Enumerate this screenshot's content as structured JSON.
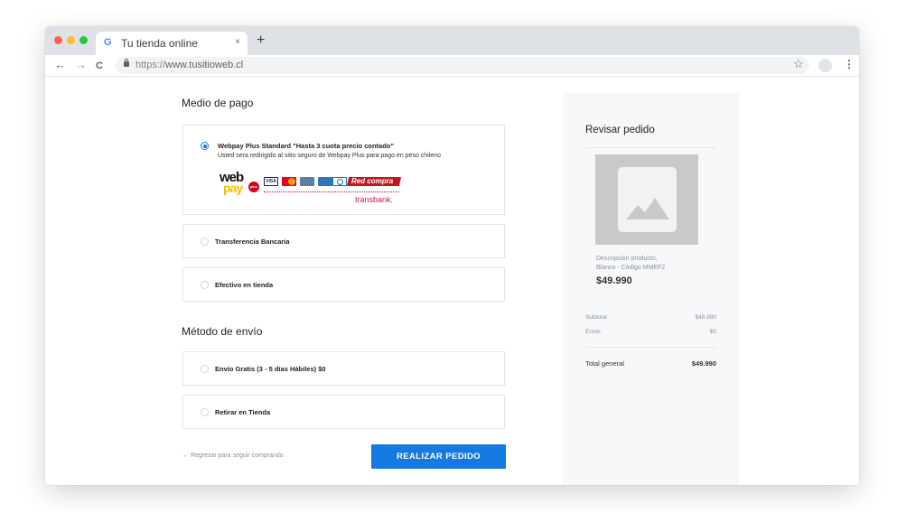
{
  "browser": {
    "tab_title": "Tu tienda online",
    "tab_icon_letter": "G",
    "tab_close": "×",
    "new_tab": "+",
    "url_protocol": "https://",
    "url_host": "www.tusitioweb.cl",
    "back": "←",
    "forward": "→",
    "reload": "C",
    "star": "☆",
    "menu": "⋮"
  },
  "payment": {
    "heading": "Medio de pago",
    "options": [
      {
        "label": "Webpay Plus Standard \"Hasta 3 cuota precio contado\"",
        "description": "Usted sera redirigido al sitio seguro de Webpay Plus para pago en peso chileno",
        "selected": true
      },
      {
        "label": "Transferencia Bancaria",
        "selected": false
      },
      {
        "label": "Efectivo en tienda",
        "selected": false
      }
    ],
    "webpay_logo": {
      "top": "web",
      "bottom": "pay",
      "plus": "plus"
    },
    "cards": [
      "VISA",
      "MasterCard",
      "Magna",
      "American Express",
      "Diners"
    ],
    "redcompra": "Red compra",
    "transbank": "transbank."
  },
  "shipping": {
    "heading": "Método de envío",
    "options": [
      {
        "label": "Envío Gratis (3 - 5 días Hábiles) $0",
        "selected": false
      },
      {
        "label": "Retirar en Tienda",
        "selected": false
      }
    ]
  },
  "footer": {
    "back_link": "← Regresar para seguir comprando",
    "submit": "REALIZAR PEDIDO"
  },
  "order": {
    "heading": "Revisar pedido",
    "product_desc_line1": "Descripción producto,",
    "product_desc_line2": "Blanco - Código MMEF2",
    "product_price": "$49.990",
    "subtotal_label": "Subtotal",
    "subtotal_value": "$49.990",
    "shipping_label": "Envío",
    "shipping_value": "$0",
    "total_label": "Total general",
    "total_value": "$49.990"
  },
  "colors": {
    "accent": "#1479e0",
    "panel_bg": "#f7f8fa",
    "placeholder": "#c9c9c9",
    "webpay_red": "#d0021b",
    "webpay_yellow": "#f2c200"
  }
}
